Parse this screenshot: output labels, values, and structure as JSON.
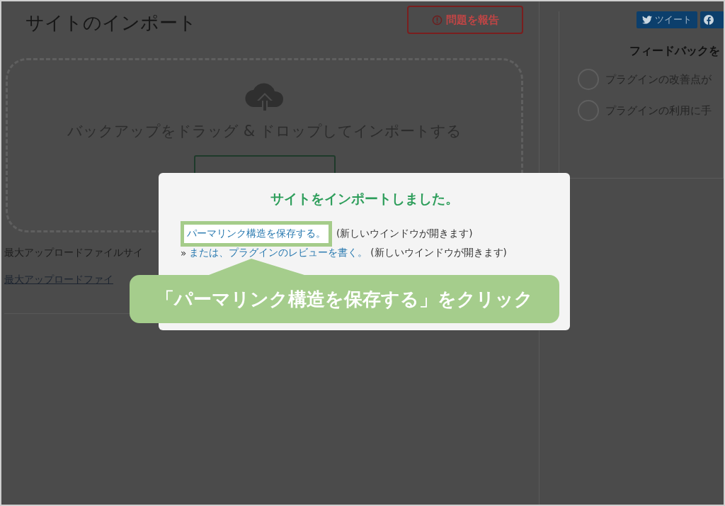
{
  "page": {
    "title": "サイトのインポート",
    "report_button": "問題を報告",
    "dropzone_text": "バックアップをドラッグ & ドロップしてインポートする",
    "max_upload_text": "最大アップロードファイルサイ",
    "max_upload_link": "最大アップロードファイ"
  },
  "sidebar": {
    "share_buttons": [
      {
        "kind": "twitter",
        "label": "ツイート"
      },
      {
        "kind": "facebook"
      }
    ],
    "feedback": {
      "title": "フィードバックを",
      "options": [
        {
          "label": "プラグインの改善点が",
          "selected": false
        },
        {
          "label": "プラグインの利用に手",
          "selected": false
        }
      ]
    }
  },
  "dialog": {
    "title": "サイトをインポートしました。",
    "links": [
      {
        "link": "パーマリンク構造を保存する。",
        "note": "(新しいウインドウが開きます)",
        "highlighted": true
      },
      {
        "prefix": "»",
        "link": "または、プラグインのレビューを書く。",
        "note": "(新しいウインドウが開きます)",
        "highlighted": false
      }
    ]
  },
  "callout": {
    "text": "「パーマリンク構造を保存する」をクリック"
  }
}
